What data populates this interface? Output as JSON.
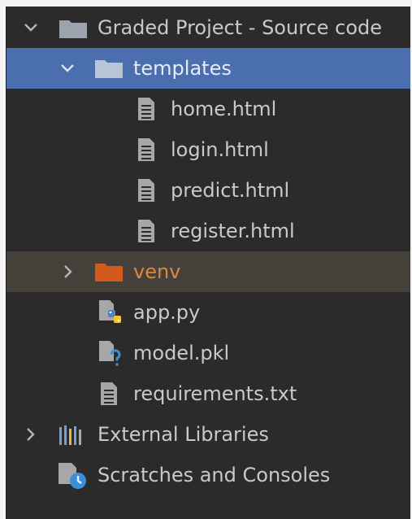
{
  "project_tree": {
    "items": [
      {
        "label": "Graded Project - Source code",
        "type": "folder",
        "expanded": true,
        "icon": "folder-icon"
      },
      {
        "label": "templates",
        "type": "folder",
        "expanded": true,
        "selected": true,
        "icon": "folder-icon"
      },
      {
        "label": "home.html",
        "type": "file",
        "icon": "html-file-icon"
      },
      {
        "label": "login.html",
        "type": "file",
        "icon": "html-file-icon"
      },
      {
        "label": "predict.html",
        "type": "file",
        "icon": "html-file-icon"
      },
      {
        "label": "register.html",
        "type": "file",
        "icon": "html-file-icon"
      },
      {
        "label": "venv",
        "type": "folder",
        "expanded": false,
        "excluded": true,
        "icon": "excluded-folder-icon"
      },
      {
        "label": "app.py",
        "type": "file",
        "icon": "python-file-icon"
      },
      {
        "label": "model.pkl",
        "type": "file",
        "icon": "unknown-file-icon"
      },
      {
        "label": "requirements.txt",
        "type": "file",
        "icon": "text-file-icon"
      },
      {
        "label": "External Libraries",
        "type": "library",
        "expanded": false,
        "icon": "library-icon"
      },
      {
        "label": "Scratches and Consoles",
        "type": "scratches",
        "icon": "scratches-icon"
      }
    ]
  },
  "colors": {
    "background": "#2b2b2b",
    "selection": "#4b6eaf",
    "excluded_row": "#45403a",
    "excluded_folder": "#d35a1c",
    "folder": "#9ca3ad",
    "text": "#c9c9c9"
  }
}
